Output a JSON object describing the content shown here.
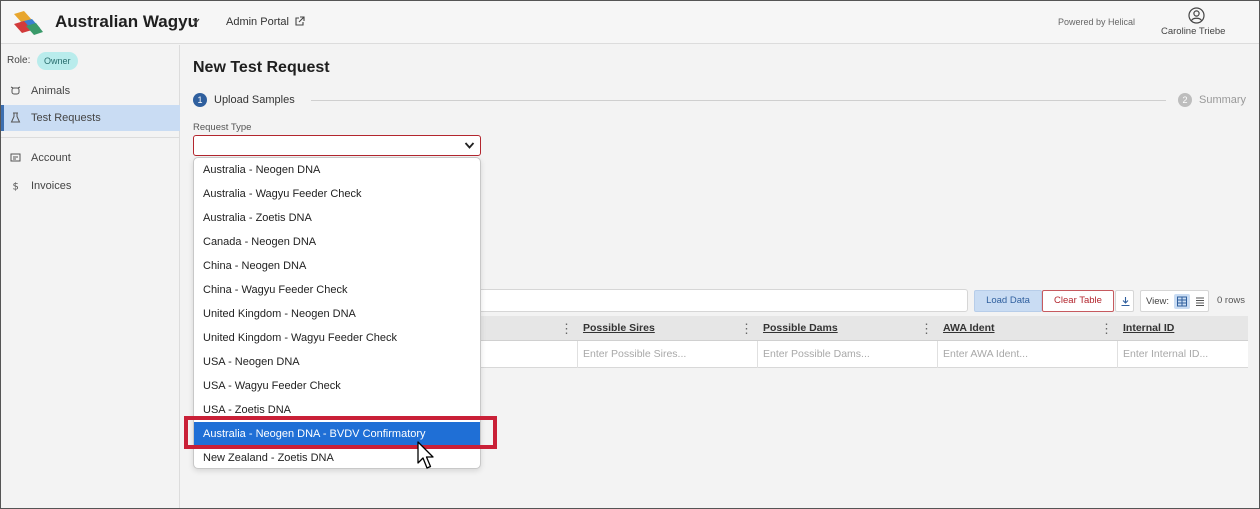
{
  "header": {
    "brand": "Australian Wagyu",
    "admin_portal": "Admin Portal",
    "powered_by": "Powered by Helical",
    "user_name": "Caroline Triebe"
  },
  "sidebar": {
    "role_label": "Role:",
    "role_badge": "Owner",
    "items": [
      {
        "label": "Animals",
        "icon": "cow-icon"
      },
      {
        "label": "Test Requests",
        "icon": "flask-icon"
      },
      {
        "label": "Account",
        "icon": "account-card-icon"
      },
      {
        "label": "Invoices",
        "icon": "dollar-icon"
      }
    ]
  },
  "main": {
    "title": "New Test Request",
    "steps": [
      {
        "number": "1",
        "label": "Upload Samples"
      },
      {
        "number": "2",
        "label": "Summary"
      }
    ],
    "request_type_label": "Request Type",
    "request_type_value": "",
    "toolbar": {
      "load_data": "Load Data",
      "clear_table": "Clear Table",
      "view_label": "View:",
      "rows_count": "0 rows"
    },
    "table": {
      "columns": [
        "Possible Sires",
        "Possible Dams",
        "AWA Ident",
        "Internal ID"
      ],
      "placeholders": [
        "Enter Possible Sires...",
        "Enter Possible Dams...",
        "Enter AWA Ident...",
        "Enter Internal ID..."
      ]
    }
  },
  "dropdown": {
    "options": [
      "Australia - Neogen DNA",
      "Australia - Wagyu Feeder Check",
      "Australia - Zoetis DNA",
      "Canada - Neogen DNA",
      "China - Neogen DNA",
      "China - Wagyu Feeder Check",
      "United Kingdom - Neogen DNA",
      "United Kingdom - Wagyu Feeder Check",
      "USA - Neogen DNA",
      "USA - Wagyu Feeder Check",
      "USA - Zoetis DNA",
      "Australia - Neogen DNA - BVDV Confirmatory",
      "New Zealand - Zoetis DNA"
    ],
    "selected_index": 11
  },
  "colors": {
    "accent_blue": "#2f5f9e",
    "selected_option": "#1f6fd6",
    "error_red": "#b3262e",
    "highlight_red": "#c92037",
    "badge_teal": "#b9ecec"
  }
}
